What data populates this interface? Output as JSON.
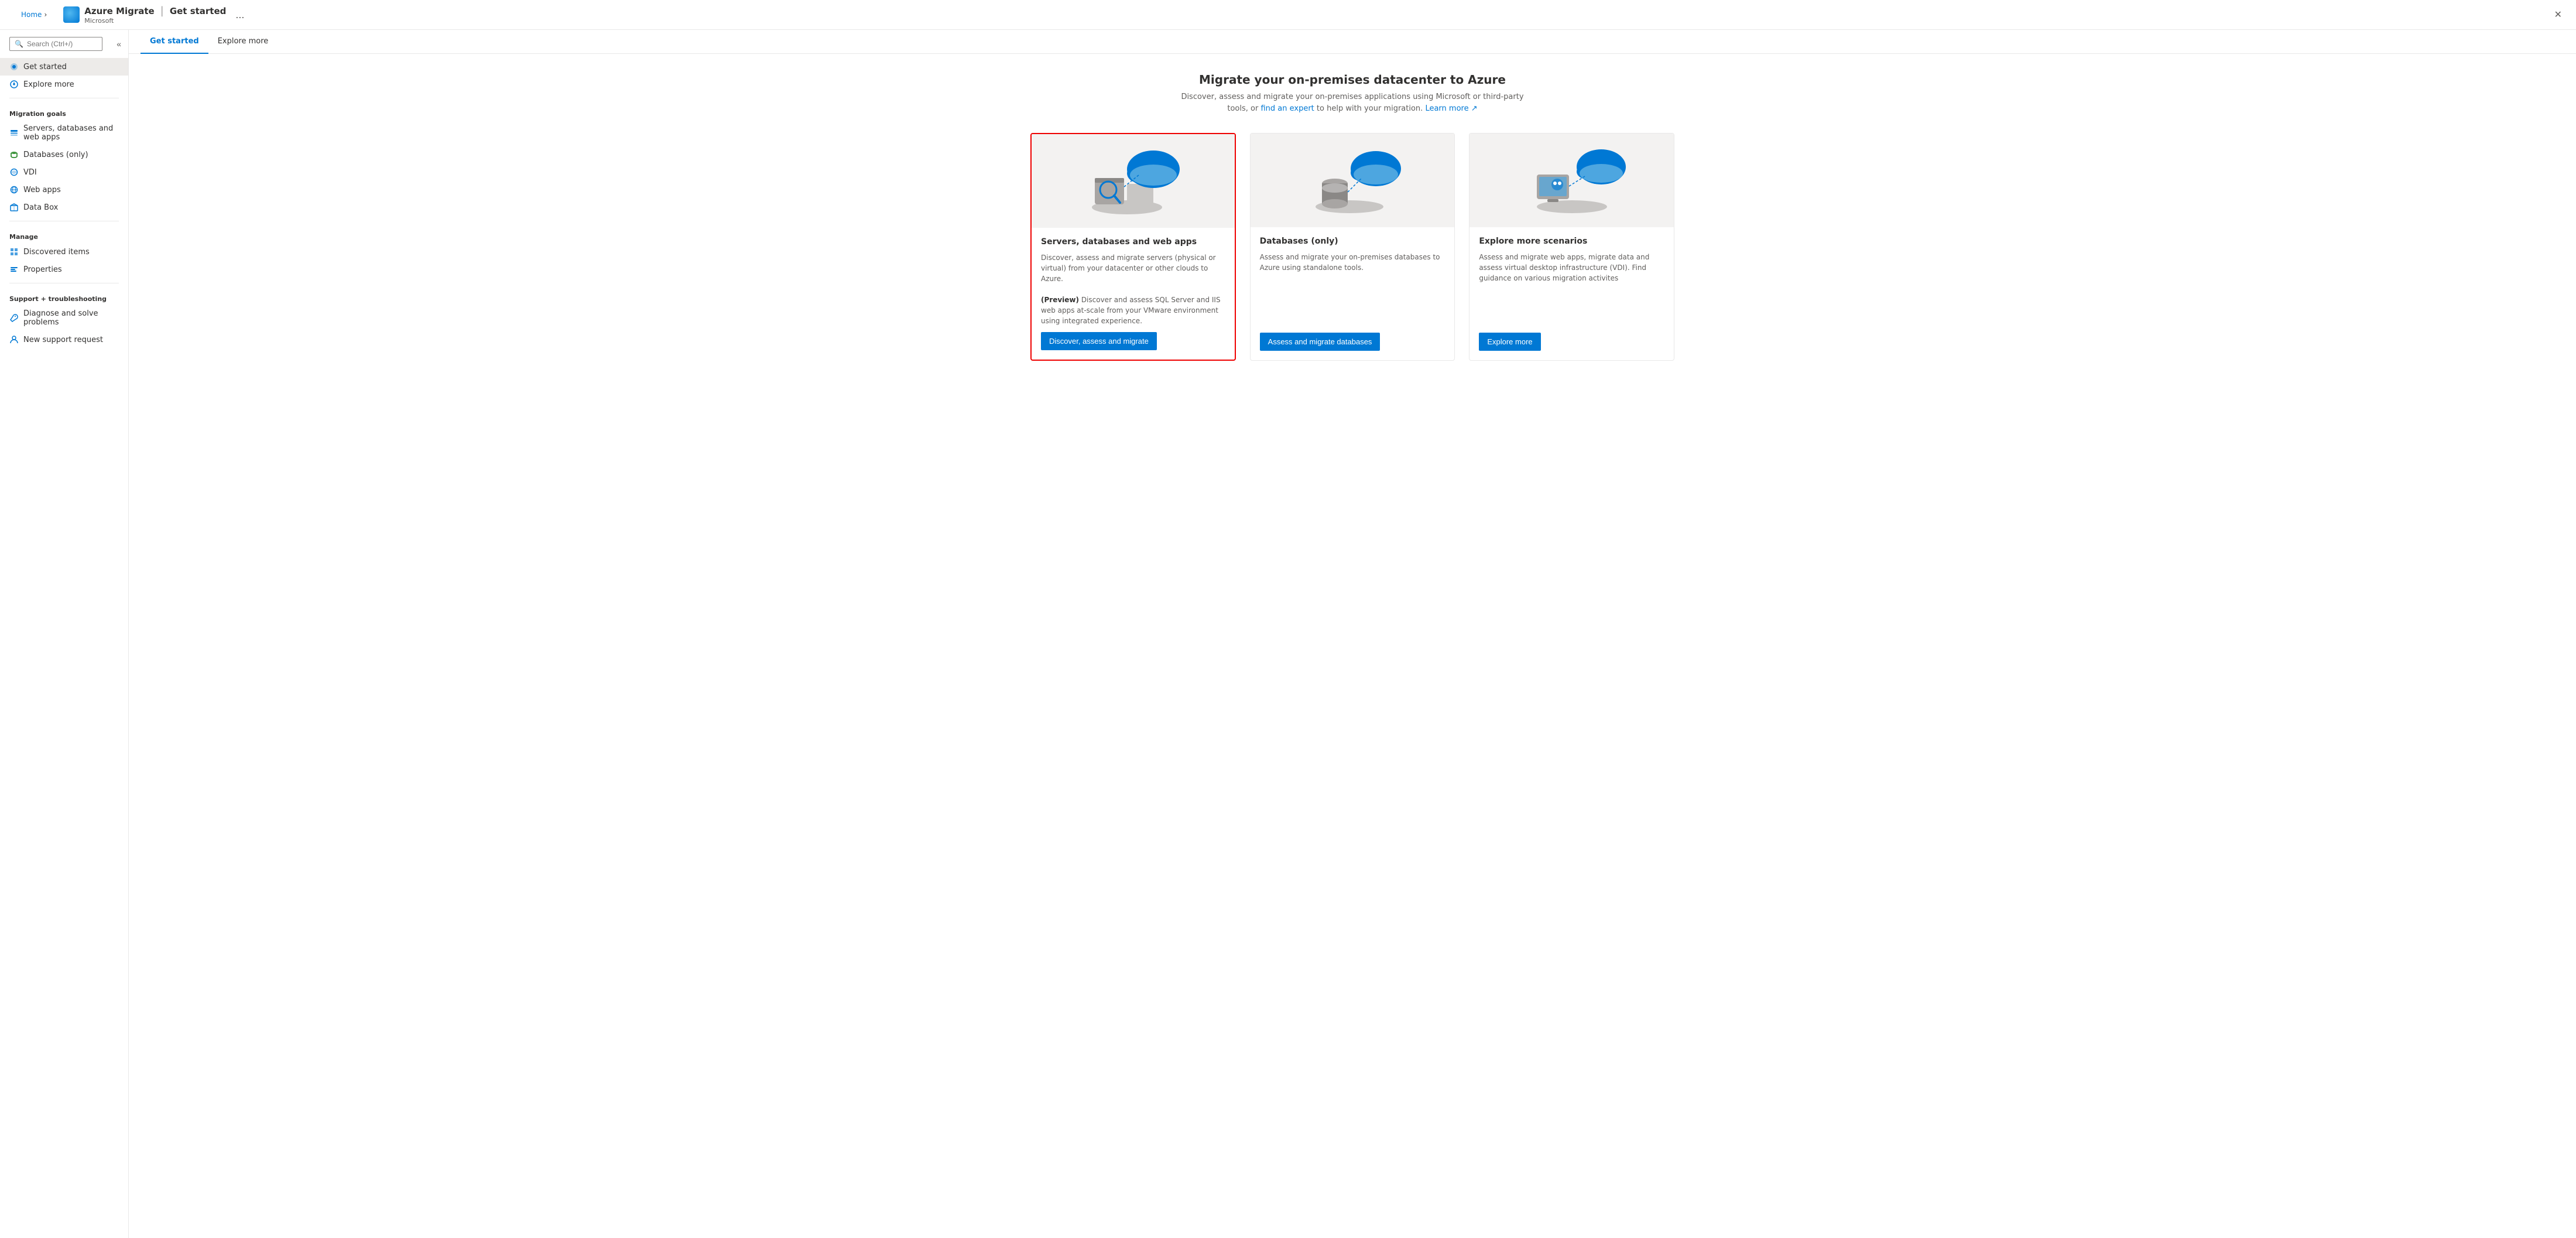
{
  "app": {
    "icon_alt": "Azure Migrate icon",
    "title": "Azure Migrate",
    "separator": "|",
    "page_title": "Get started",
    "subtitle": "Microsoft",
    "ellipsis": "...",
    "close": "✕"
  },
  "breadcrumb": {
    "home_label": "Home",
    "separator": "›"
  },
  "search": {
    "placeholder": "Search (Ctrl+/)"
  },
  "tabs": [
    {
      "label": "Get started",
      "active": true
    },
    {
      "label": "Explore more",
      "active": false
    }
  ],
  "hero": {
    "title": "Migrate your on-premises datacenter to Azure",
    "description": "Discover, assess and migrate your on-premises applications using Microsoft or third-party tools, or",
    "link1_text": "find an expert",
    "link1_middle": "to help with your migration.",
    "link2_text": "Learn more",
    "external_icon": "↗"
  },
  "sidebar": {
    "nav_items": [
      {
        "id": "get-started",
        "label": "Get started",
        "icon": "rocket",
        "active": true
      },
      {
        "id": "explore-more",
        "label": "Explore more",
        "icon": "compass",
        "active": false
      }
    ],
    "sections": [
      {
        "label": "Migration goals",
        "items": [
          {
            "id": "servers-dbs-webapps",
            "label": "Servers, databases and web apps",
            "icon": "server"
          },
          {
            "id": "databases-only",
            "label": "Databases (only)",
            "icon": "database"
          },
          {
            "id": "vdi",
            "label": "VDI",
            "icon": "desktop"
          },
          {
            "id": "web-apps",
            "label": "Web apps",
            "icon": "globe"
          },
          {
            "id": "data-box",
            "label": "Data Box",
            "icon": "box"
          }
        ]
      },
      {
        "label": "Manage",
        "items": [
          {
            "id": "discovered-items",
            "label": "Discovered items",
            "icon": "grid"
          },
          {
            "id": "properties",
            "label": "Properties",
            "icon": "bars"
          }
        ]
      },
      {
        "label": "Support + troubleshooting",
        "items": [
          {
            "id": "diagnose",
            "label": "Diagnose and solve problems",
            "icon": "wrench"
          },
          {
            "id": "support-request",
            "label": "New support request",
            "icon": "person"
          }
        ]
      }
    ]
  },
  "cards": [
    {
      "id": "servers-card",
      "title": "Servers, databases and web apps",
      "description": "Discover, assess and migrate servers (physical or virtual) from your datacenter or other clouds to Azure.",
      "description2": "(Preview) Discover and assess SQL Server and IIS web apps at-scale from your VMware environment using integrated experience.",
      "button_label": "Discover, assess and migrate",
      "selected": true
    },
    {
      "id": "databases-card",
      "title": "Databases (only)",
      "description": "Assess and migrate your on-premises databases to Azure using standalone tools.",
      "description2": "",
      "button_label": "Assess and migrate databases",
      "selected": false
    },
    {
      "id": "explore-card",
      "title": "Explore more scenarios",
      "description": "Assess and migrate web apps, migrate data and assess virtual desktop infrastructure (VDI). Find guidance on various migration activites",
      "description2": "",
      "button_label": "Explore more",
      "selected": false
    }
  ],
  "colors": {
    "accent": "#0078d4",
    "selected_border": "#cc0000",
    "sidebar_active_bg": "#edebe9"
  }
}
